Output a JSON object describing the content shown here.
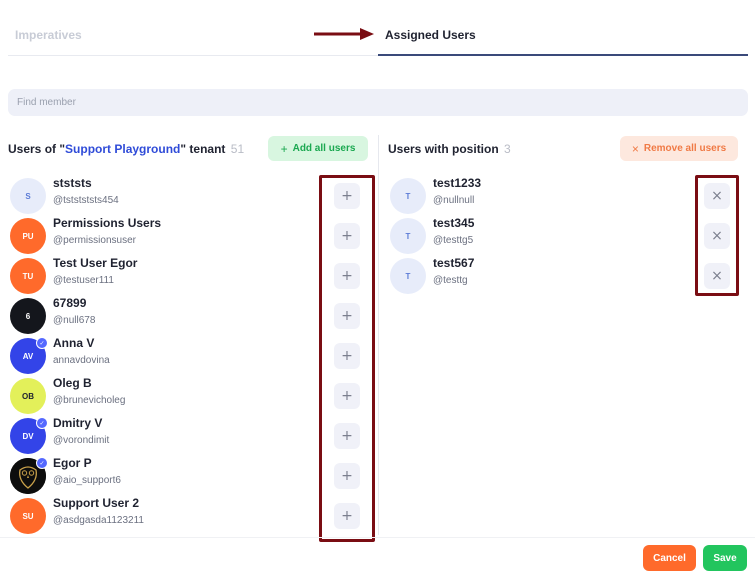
{
  "tabs": {
    "inactive_label": "Imperatives",
    "active_label": "Assigned Users"
  },
  "search": {
    "placeholder": "Find member"
  },
  "left_panel": {
    "title_prefix": "Users of \"",
    "tenant_name": "Support Playground",
    "title_suffix": "\" tenant",
    "count": "51",
    "add_all_label": "Add all users",
    "add_icon": "plus-icon",
    "users": [
      {
        "initials": "S",
        "name": "stststs",
        "handle": "@tststststs454",
        "avatar_bg": "#e7ecfa",
        "avatar_fg": "#5b7bd6",
        "badge": false
      },
      {
        "initials": "PU",
        "name": "Permissions Users",
        "handle": "@permissionsuser",
        "avatar_bg": "#ff6a2b",
        "avatar_fg": "#ffffff",
        "badge": false
      },
      {
        "initials": "TU",
        "name": "Test User Egor",
        "handle": "@testuser111",
        "avatar_bg": "#ff6a2b",
        "avatar_fg": "#ffffff",
        "badge": false
      },
      {
        "initials": "6",
        "name": "67899",
        "handle": "@null678",
        "avatar_bg": "#14161c",
        "avatar_fg": "#ffffff",
        "badge": false
      },
      {
        "initials": "AV",
        "name": "Anna V",
        "handle": "annavdovina",
        "avatar_bg": "#3344e8",
        "avatar_fg": "#ffffff",
        "badge": true
      },
      {
        "initials": "OB",
        "name": "Oleg B",
        "handle": "@brunevicholeg",
        "avatar_bg": "#e3f05a",
        "avatar_fg": "#1f2230",
        "badge": false
      },
      {
        "initials": "DV",
        "name": "Dmitry V",
        "handle": "@vorondimit",
        "avatar_bg": "#3344e8",
        "avatar_fg": "#ffffff",
        "badge": true
      },
      {
        "initials": "",
        "name": "Egor P",
        "handle": "@aio_support6",
        "avatar_bg": "#0d0d0d",
        "avatar_fg": "#ffffff",
        "badge": true
      },
      {
        "initials": "SU",
        "name": "Support User 2",
        "handle": "@asdgasda1123211",
        "avatar_bg": "#ff6a2b",
        "avatar_fg": "#ffffff",
        "badge": false
      }
    ]
  },
  "right_panel": {
    "title": "Users with position",
    "count": "3",
    "remove_all_label": "Remove all users",
    "remove_icon": "close-icon",
    "users": [
      {
        "initials": "T",
        "name": "test1233",
        "handle": "@nullnull"
      },
      {
        "initials": "T",
        "name": "test345",
        "handle": "@testtg5"
      },
      {
        "initials": "T",
        "name": "test567",
        "handle": "@testtg"
      }
    ]
  },
  "row_button_glyphs": {
    "add": "+",
    "remove": "×"
  },
  "footer": {
    "cancel_label": "Cancel",
    "save_label": "Save"
  },
  "colors": {
    "accent_link": "#2f4bd8",
    "highlight_box": "#7a0d13",
    "arrow": "#7a0d13",
    "cancel": "#ff6a2b",
    "save": "#22c55e"
  }
}
